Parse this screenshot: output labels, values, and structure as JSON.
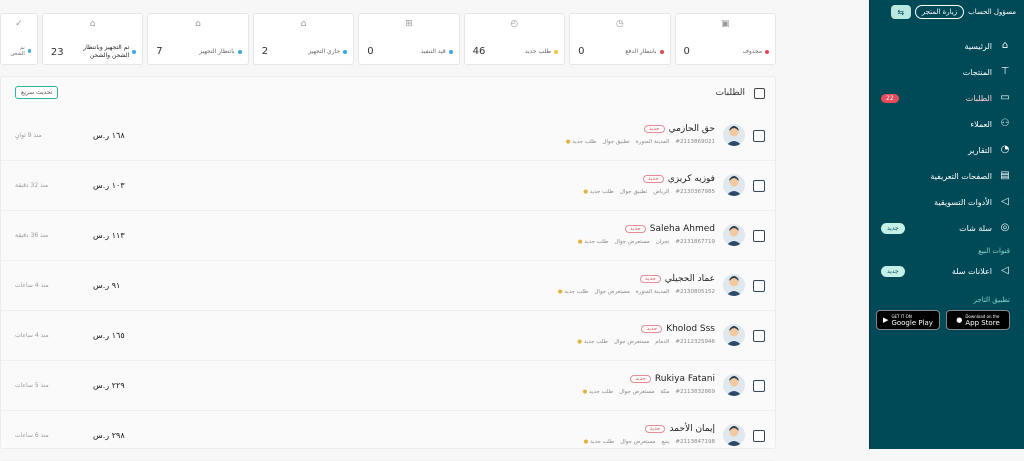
{
  "sidebar": {
    "account_link": "مسؤول الحساب",
    "visit_store": "زيارة المتجر",
    "nav": [
      {
        "label": "الرئيسية",
        "icon": "home-icon"
      },
      {
        "label": "المنتجات",
        "icon": "shirt-icon"
      },
      {
        "label": "الطلبات",
        "icon": "orders-icon",
        "badge": "22"
      },
      {
        "label": "العملاء",
        "icon": "users-icon"
      },
      {
        "label": "التقارير",
        "icon": "chart-icon"
      },
      {
        "label": "الصفحات التعريفية",
        "icon": "pages-icon"
      },
      {
        "label": "الأدوات التسويقية",
        "icon": "megaphone-icon"
      },
      {
        "label": "سلة شات",
        "icon": "chat-icon",
        "badge": "جديد"
      }
    ],
    "sales_section": "قنوات البيع",
    "sales_nav": [
      {
        "label": "اعلانات سلة",
        "icon": "megaphone-icon",
        "badge": "جديد"
      }
    ],
    "app_section": "تطبيق التاجر",
    "google_play": {
      "small": "GET IT ON",
      "big": "Google Play"
    },
    "app_store": {
      "small": "Download on the",
      "big": "App Store"
    }
  },
  "stats": [
    {
      "label": "محذوف",
      "value": "0",
      "color": "#e5484d",
      "icon": "box-icon"
    },
    {
      "label": "بانتظار الدفع",
      "value": "0",
      "color": "#e5484d",
      "icon": "watch-icon"
    },
    {
      "label": "طلب جديد",
      "value": "46",
      "color": "#f0c93a",
      "icon": "clock-icon"
    },
    {
      "label": "قيد التنفيذ",
      "value": "0",
      "color": "#3aa8e0",
      "icon": "gift-icon"
    },
    {
      "label": "جاري التجهيز",
      "value": "2",
      "color": "#3aa8e0",
      "icon": "store-icon"
    },
    {
      "label": "بانتظار التجهيز",
      "value": "7",
      "color": "#3aa8e0",
      "icon": "store-icon"
    },
    {
      "label": "تم التجهيز وبانتظار الشحن والشحن",
      "value": "23",
      "color": "#3aa8e0",
      "icon": "store-icon"
    },
    {
      "label": "تم الشحن",
      "value": "",
      "color": "#3aa8e0",
      "icon": "check-icon"
    }
  ],
  "orders": {
    "title": "الطلبات",
    "quick_action": "تحديث سريع",
    "items": [
      {
        "name": "حق الحازمي",
        "tag": "جديد",
        "id": "#2113869021",
        "city": "المدينة المنورة",
        "source": "تطبيق جوال",
        "status": "طلب جديد",
        "price": "١٦٨ ر.س",
        "time": "منذ 9 ثوانٍ"
      },
      {
        "name": "فوزيه كريزي",
        "tag": "جديد",
        "id": "#2130367985",
        "city": "الرياض",
        "source": "تطبيق جوال",
        "status": "طلب جديد",
        "price": "١٠٣ ر.س",
        "time": "منذ 32 دقيقة"
      },
      {
        "name": "Saleha Ahmed",
        "tag": "جديد",
        "id": "#2131867719",
        "city": "نجران",
        "source": "مستعرض جوال",
        "status": "طلب جديد",
        "price": "١١٣ ر.س",
        "time": "منذ 36 دقيقة"
      },
      {
        "name": "عماد الحجيلي",
        "tag": "جديد",
        "id": "#2130805152",
        "city": "المدينة المنورة",
        "source": "مستعرض جوال",
        "status": "طلب جديد",
        "price": "٩١ ر.س",
        "time": "منذ 4 ساعات"
      },
      {
        "name": "Kholod Sss",
        "tag": "جديد",
        "id": "#2112325946",
        "city": "الدمام",
        "source": "مستعرض جوال",
        "status": "طلب جديد",
        "price": "١٦٥ ر.س",
        "time": "منذ 4 ساعات"
      },
      {
        "name": "Rukiya Fatani",
        "tag": "جديد",
        "id": "#2113832869",
        "city": "مكة",
        "source": "مستعرض جوال",
        "status": "طلب جديد",
        "price": "٢٢٩ ر.س",
        "time": "منذ 5 ساعات"
      },
      {
        "name": "إيمان الأحمد",
        "tag": "جديد",
        "id": "#2113847198",
        "city": "ينبع",
        "source": "مستعرض جوال",
        "status": "طلب جديد",
        "price": "٢٩٨ ر.س",
        "time": "منذ 6 ساعات"
      }
    ]
  }
}
